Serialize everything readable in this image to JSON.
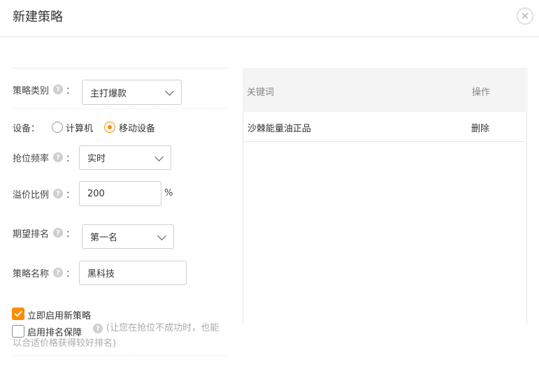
{
  "dialog": {
    "title": "新建策略",
    "close_icon": "close-icon"
  },
  "form": {
    "strategy_type": {
      "label": "策略类别",
      "colon": "：",
      "value": "主打爆款"
    },
    "device": {
      "label": "设备：",
      "options": [
        {
          "label": "计算机",
          "selected": false
        },
        {
          "label": "移动设备",
          "selected": true
        }
      ]
    },
    "frequency": {
      "label": "抢位频率",
      "colon": "：",
      "value": "实时"
    },
    "premium_ratio": {
      "label": "溢价比例",
      "colon": "：",
      "value": "200",
      "unit": "%"
    },
    "expected_rank": {
      "label": "期望排名",
      "colon": "：",
      "value": "第一名"
    },
    "strategy_name": {
      "label": "策略名称",
      "colon": "：",
      "value": "黑科技"
    },
    "enable_now": {
      "label": "立即启用新策略",
      "checked": true
    },
    "rank_guarantee": {
      "label": "启用排名保障",
      "checked": false,
      "note_line1": "(让您在抢位不成功时，也能",
      "note_line2": "以合适价格获得较好排名)"
    },
    "help_icon": "?"
  },
  "keyword_table": {
    "headers": [
      "关键词",
      "操作"
    ],
    "rows": [
      {
        "keyword": "沙棘能量油正品",
        "action": "删除"
      }
    ]
  },
  "colors": {
    "accent": "#ff8c00",
    "header_bg": "#f4f4f4",
    "border": "#cfcfcf"
  }
}
